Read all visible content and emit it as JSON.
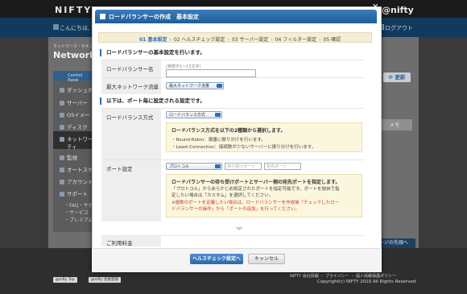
{
  "background": {
    "logo_left": "NIFTY",
    "logo_right": "@nifty",
    "greeting": "こんにちは,",
    "logout": "ログアウト",
    "breadcrumb": "ネットワーク・セキュリ",
    "page_title": "Network",
    "sidebar_header": "Control Panel",
    "sidebar_items": [
      {
        "label": "ダッシュボ",
        "icon": "dashboard-icon"
      },
      {
        "label": "サーバー",
        "icon": "server-icon"
      },
      {
        "label": "OSイメー",
        "icon": "os-image-icon"
      },
      {
        "label": "ディスク",
        "icon": "disk-icon"
      },
      {
        "label": "ネットワー",
        "icon": "network-icon"
      },
      {
        "label": "ティ",
        "icon": ""
      },
      {
        "label": "監視",
        "icon": "monitor-icon"
      },
      {
        "label": "オートスケ",
        "icon": "autoscale-icon"
      },
      {
        "label": "アカウント",
        "icon": "account-icon"
      },
      {
        "label": "サポート",
        "icon": "support-icon"
      }
    ],
    "support_sub": [
      "FAQ・サポ",
      "サービス",
      "プレミアム"
    ],
    "update_button": "更新",
    "memo": "メモ",
    "page_top": "ージの先頭へ",
    "footer_links": "NIFTY 会社情報  ・  プライバシー  ・  個人情報保護ポリシー",
    "copyright": "Copyright(c) NIFTY 2010 All Rights Reserved.",
    "footer_btn_top": "@nifty Top",
    "footer_btn_company": "@nifty 会員登録"
  },
  "modal": {
    "title": "ロードバランサーの作成　基本設定",
    "close": "×",
    "steps": [
      {
        "label": "01 基本設定",
        "active": true
      },
      {
        "label": "02 ヘルスチェック設定",
        "active": false
      },
      {
        "label": "03 サーバー設定",
        "active": false
      },
      {
        "label": "04 フィルター設定",
        "active": false
      },
      {
        "label": "05 確認",
        "active": false
      }
    ],
    "section1": "ロードバランサーの基本設定を行います。",
    "lb_name_label": "ロードバランサー名",
    "lb_name_hint": "(英数字1〜15文字)",
    "max_traffic_label": "最大ネットワーク流量",
    "max_traffic_value": "最大ネットワーク流量",
    "section2": "以下は、ポート毎に設定される設定です。",
    "lb_method_label": "ロードバランス方式",
    "lb_method_value": "ロードバランス方式",
    "lb_info": {
      "title": "ロードバランス方式を以下の2種類から選択します。",
      "lines": [
        "・Round-Robin：順番に振り分けを行います。",
        "・Least-Connection：接続数が少ないサーバーに振り分けを行います。"
      ]
    },
    "port_label": "ポート設定",
    "protocol_value": "プロトコル",
    "lb_port_placeholder": "待ち受けポート",
    "dest_port_placeholder": "宛先ポート",
    "port_info": {
      "title": "ロードバランサーの待ち受けポートとサーバー側の宛先ポートを指定します。",
      "lines": [
        "「プロトコル」からあらかじめ設定されたポートを指定可能です。ポートを独自で指",
        "定したい場合は「カスタム」を選択してください。"
      ],
      "warn": [
        "※複数のポートを定義したい場合は、ロードバランサーを作成後「チェックしたロー",
        "ドバランサーの操作」から「ポートの追加」を行ってください。"
      ]
    },
    "fee_label": "ご利用料金",
    "next_button": "ヘルスチェック設定へ",
    "cancel_button": "キャンセル"
  }
}
